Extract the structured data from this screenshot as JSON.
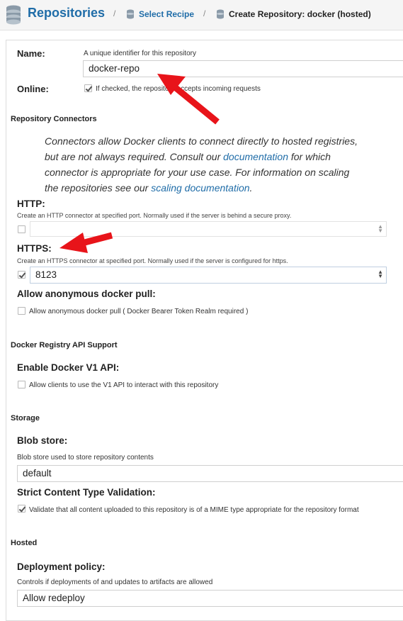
{
  "header": {
    "title": "Repositories",
    "crumbs": [
      "Select Recipe",
      "Create Repository: docker (hosted)"
    ],
    "separator": "/"
  },
  "name_field": {
    "label": "Name:",
    "help": "A unique identifier for this repository",
    "value": "docker-repo"
  },
  "online_field": {
    "label": "Online:",
    "checkbox_label": "If checked, the repository accepts incoming requests",
    "checked": true
  },
  "connectors": {
    "title": "Repository Connectors",
    "desc_1": "Connectors allow Docker clients to connect directly to hosted registries, but are not always required. Consult our ",
    "desc_link_1": "documentation",
    "desc_2": " for which connector is appropriate for your use case. For information on scaling the repositories see our ",
    "desc_link_2": "scaling documentation",
    "desc_3": ".",
    "http_label": "HTTP:",
    "http_help": "Create an HTTP connector at specified port. Normally used if the server is behind a secure proxy.",
    "http_value": "",
    "https_label": "HTTPS:",
    "https_help": "Create an HTTPS connector at specified port. Normally used if the server is configured for https.",
    "https_value": "8123",
    "anon_label": "Allow anonymous docker pull:",
    "anon_checkbox": "Allow anonymous docker pull ( Docker Bearer Token Realm required )"
  },
  "api": {
    "title": "Docker Registry API Support",
    "v1_label": "Enable Docker V1 API:",
    "v1_checkbox": "Allow clients to use the V1 API to interact with this repository"
  },
  "storage": {
    "title": "Storage",
    "blob_label": "Blob store:",
    "blob_help": "Blob store used to store repository contents",
    "blob_value": "default",
    "strict_label": "Strict Content Type Validation:",
    "strict_checkbox": "Validate that all content uploaded to this repository is of a MIME type appropriate for the repository format"
  },
  "hosted": {
    "title": "Hosted",
    "policy_label": "Deployment policy:",
    "policy_help": "Controls if deployments of and updates to artifacts are allowed",
    "policy_value": "Allow redeploy"
  },
  "colors": {
    "link": "#206da8",
    "arrow": "#e8141a"
  }
}
